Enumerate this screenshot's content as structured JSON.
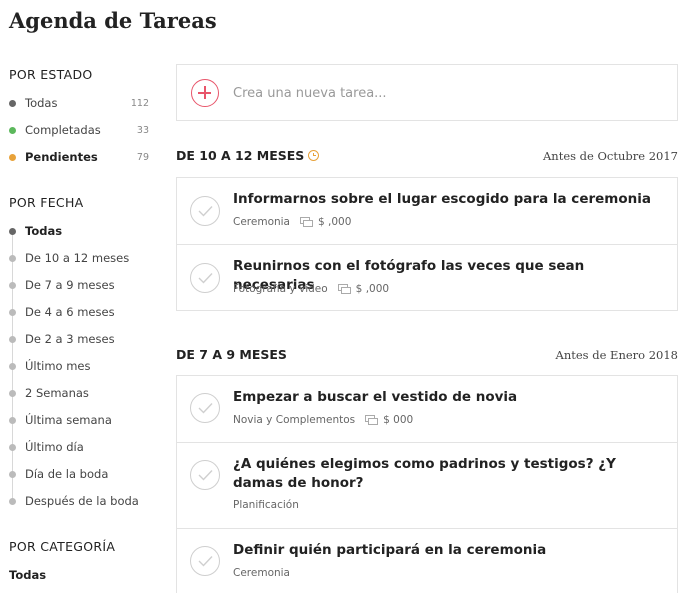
{
  "page": {
    "title": "Agenda de Tareas"
  },
  "sidebar": {
    "by_status": {
      "heading": "POR ESTADO",
      "items": [
        {
          "label": "Todas",
          "count": "112",
          "color": "#666666"
        },
        {
          "label": "Completadas",
          "count": "33",
          "color": "#5cb85c"
        },
        {
          "label": "Pendientes",
          "count": "79",
          "color": "#e8a23a"
        }
      ]
    },
    "by_date": {
      "heading": "POR FECHA",
      "items": [
        {
          "label": "Todas"
        },
        {
          "label": "De 10 a 12 meses"
        },
        {
          "label": "De 7 a 9 meses"
        },
        {
          "label": "De 4 a 6 meses"
        },
        {
          "label": "De 2 a 3 meses"
        },
        {
          "label": "Último mes"
        },
        {
          "label": "2 Semanas"
        },
        {
          "label": "Última semana"
        },
        {
          "label": "Último día"
        },
        {
          "label": "Día de la boda"
        },
        {
          "label": "Después de la boda"
        }
      ]
    },
    "by_category": {
      "heading": "POR CATEGORÍA",
      "items": [
        {
          "label": "Todas"
        }
      ]
    }
  },
  "new_task": {
    "placeholder": "Crea una nueva tarea..."
  },
  "sections": [
    {
      "title": "DE 10 A 12 MESES",
      "date": "Antes de Octubre 2017",
      "tasks": [
        {
          "title": "Informarnos sobre el lugar escogido para la ceremonia",
          "category": "Ceremonia",
          "price": "$ ,000"
        },
        {
          "title": "Reunirnos con el fotógrafo las veces que sean necesarias",
          "category": "Fotografía y video",
          "price": "$ ,000"
        }
      ]
    },
    {
      "title": "DE 7 A 9 MESES",
      "date": "Antes de Enero 2018",
      "tasks": [
        {
          "title": "Empezar a buscar el vestido de novia",
          "category": "Novia y Complementos",
          "price": "$ 000"
        },
        {
          "title": "¿A quiénes elegimos como padrinos y testigos? ¿Y damas de honor?",
          "category": "Planificación"
        },
        {
          "title": "Definir quién participará en la ceremonia",
          "category": "Ceremonia"
        }
      ]
    }
  ],
  "icons": {
    "add": "plus-circle-icon",
    "check": "check-circle-icon",
    "cash": "cash-icon",
    "clock": "clock-icon"
  },
  "colors": {
    "accent": "#e8556a",
    "completed": "#5cb85c",
    "pending": "#e8a23a"
  }
}
